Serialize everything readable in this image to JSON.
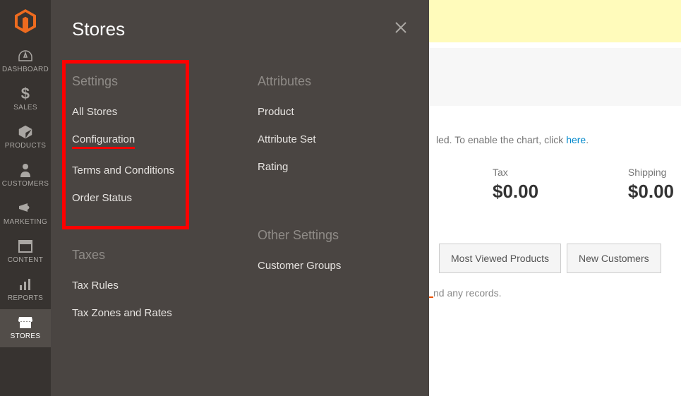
{
  "sidebar": {
    "items": [
      {
        "label": "DASHBOARD",
        "icon": "dashboard"
      },
      {
        "label": "SALES",
        "icon": "dollar"
      },
      {
        "label": "PRODUCTS",
        "icon": "cube"
      },
      {
        "label": "CUSTOMERS",
        "icon": "person"
      },
      {
        "label": "MARKETING",
        "icon": "megaphone"
      },
      {
        "label": "CONTENT",
        "icon": "layout"
      },
      {
        "label": "REPORTS",
        "icon": "bars"
      },
      {
        "label": "STORES",
        "icon": "storefront"
      }
    ],
    "active_index": 7
  },
  "flyout": {
    "title": "Stores",
    "columns": [
      {
        "groups": [
          {
            "title": "Settings",
            "items": [
              {
                "label": "All Stores"
              },
              {
                "label": "Configuration",
                "highlighted": true
              },
              {
                "label": "Terms and Conditions"
              },
              {
                "label": "Order Status"
              }
            ]
          },
          {
            "title": "Taxes",
            "items": [
              {
                "label": "Tax Rules"
              },
              {
                "label": "Tax Zones and Rates"
              }
            ]
          }
        ]
      },
      {
        "groups": [
          {
            "title": "Attributes",
            "items": [
              {
                "label": "Product"
              },
              {
                "label": "Attribute Set"
              },
              {
                "label": "Rating"
              }
            ]
          },
          {
            "title": "Other Settings",
            "items": [
              {
                "label": "Customer Groups"
              }
            ]
          }
        ]
      }
    ]
  },
  "dashboard": {
    "chart_message_prefix": "led. To enable the chart, click ",
    "chart_link": "here",
    "chart_message_suffix": ".",
    "stats": [
      {
        "label": "Tax",
        "value": "$0.00"
      },
      {
        "label": "Shipping",
        "value": "$0.00"
      }
    ],
    "tabs": [
      {
        "label": "Most Viewed Products"
      },
      {
        "label": "New Customers"
      }
    ],
    "records_message": "nd any records."
  }
}
